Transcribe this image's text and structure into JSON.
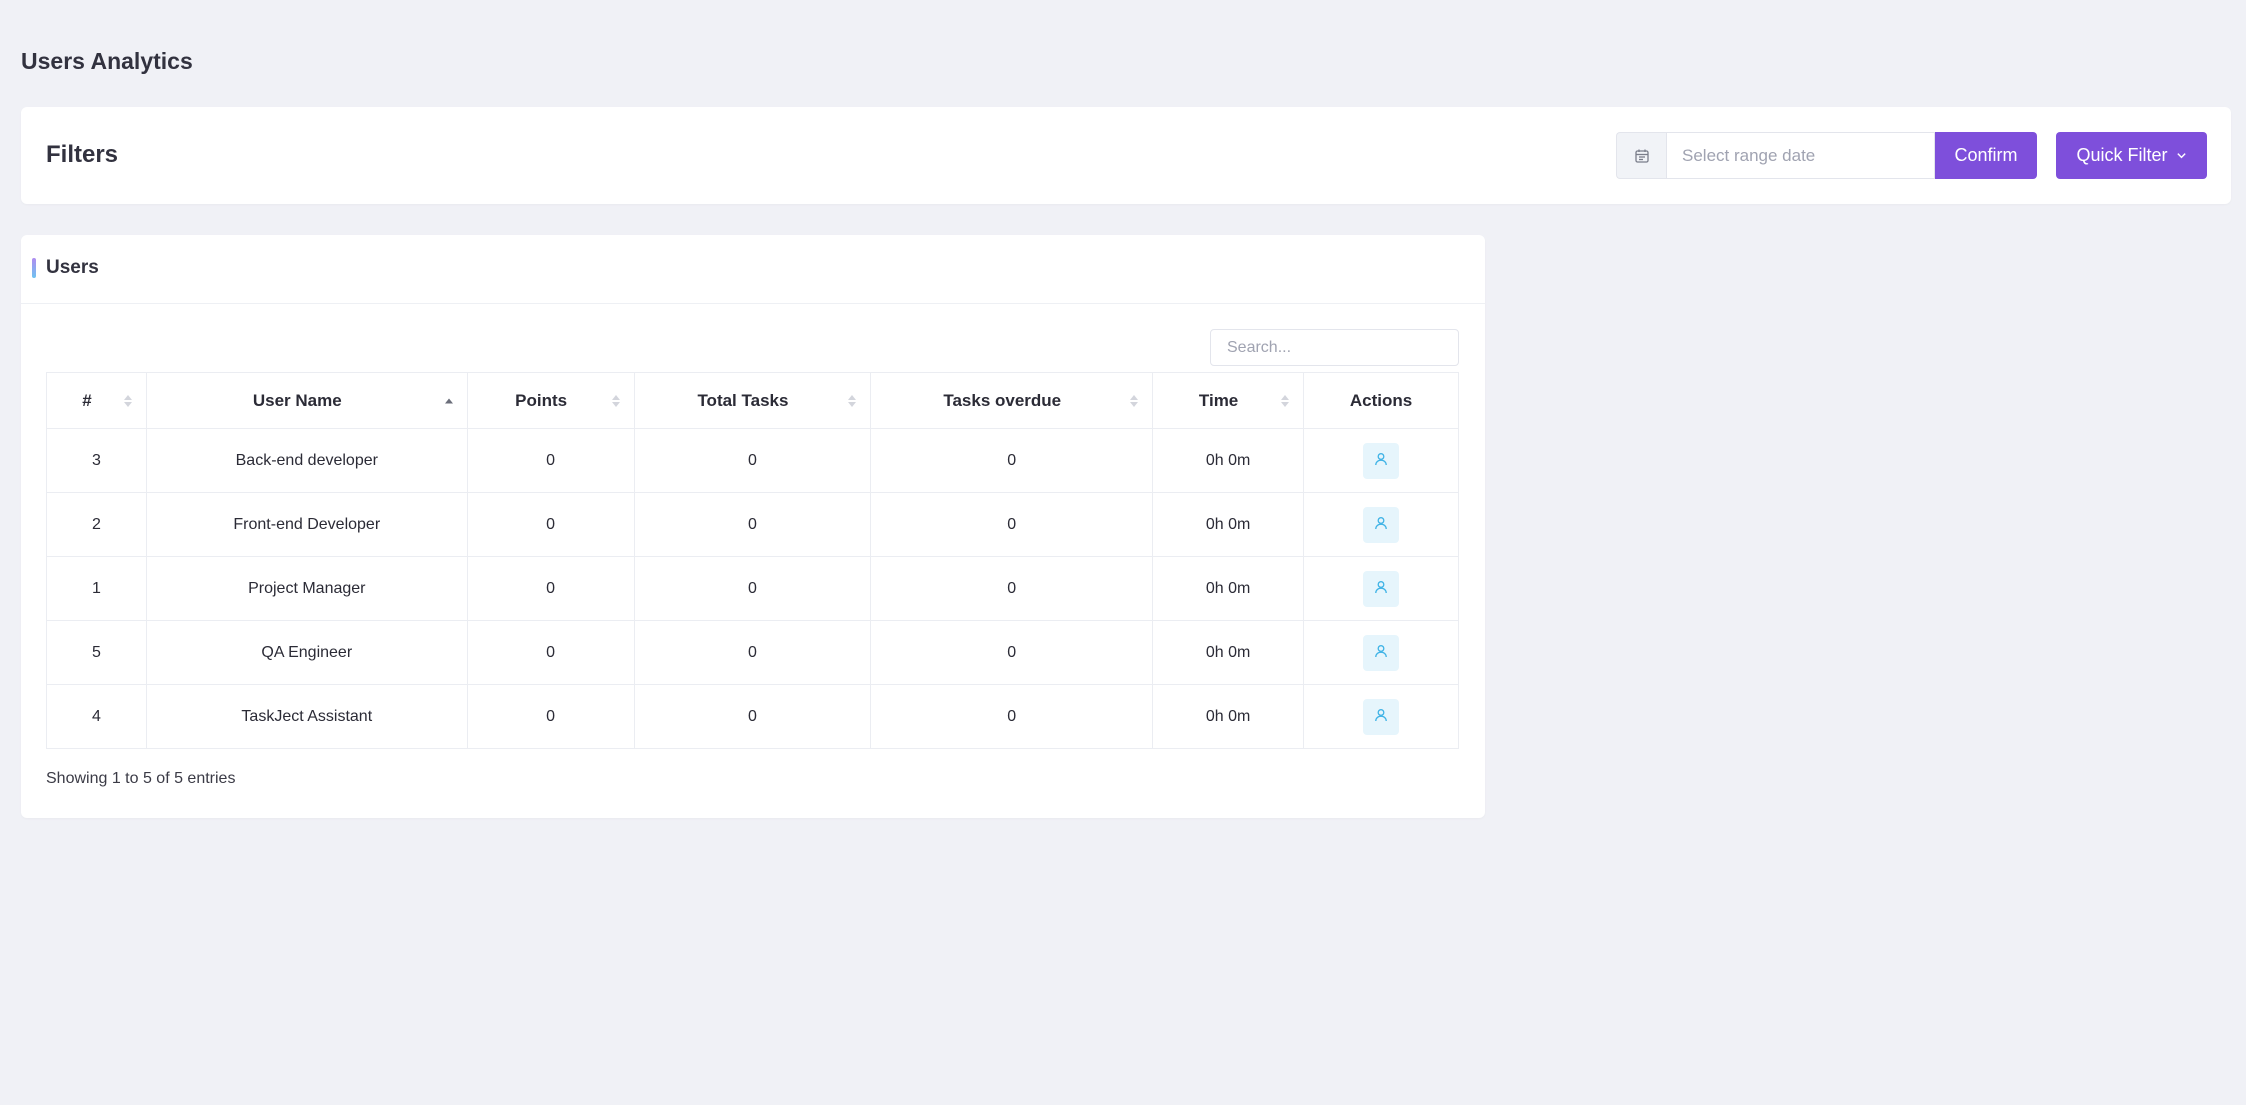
{
  "page": {
    "title": "Users Analytics"
  },
  "filters": {
    "title": "Filters",
    "date_placeholder": "Select range date",
    "confirm_label": "Confirm",
    "quick_filter_label": "Quick Filter"
  },
  "users": {
    "title": "Users",
    "search_placeholder": "Search...",
    "columns": [
      "#",
      "User Name",
      "Points",
      "Total Tasks",
      "Tasks overdue",
      "Time",
      "Actions"
    ],
    "rows": [
      {
        "id": "3",
        "name": "Back-end developer",
        "points": "0",
        "total_tasks": "0",
        "overdue": "0",
        "time": "0h 0m"
      },
      {
        "id": "2",
        "name": "Front-end Developer",
        "points": "0",
        "total_tasks": "0",
        "overdue": "0",
        "time": "0h 0m"
      },
      {
        "id": "1",
        "name": "Project Manager",
        "points": "0",
        "total_tasks": "0",
        "overdue": "0",
        "time": "0h 0m"
      },
      {
        "id": "5",
        "name": "QA Engineer",
        "points": "0",
        "total_tasks": "0",
        "overdue": "0",
        "time": "0h 0m"
      },
      {
        "id": "4",
        "name": "TaskJect Assistant",
        "points": "0",
        "total_tasks": "0",
        "overdue": "0",
        "time": "0h 0m"
      }
    ],
    "entries_info": "Showing 1 to 5 of 5 entries",
    "action_icon": "user-icon"
  },
  "colors": {
    "primary": "#7e4fdb",
    "background": "#f0f1f6",
    "action_bg": "#e6f5fc",
    "action_icon": "#3fb3e6"
  }
}
